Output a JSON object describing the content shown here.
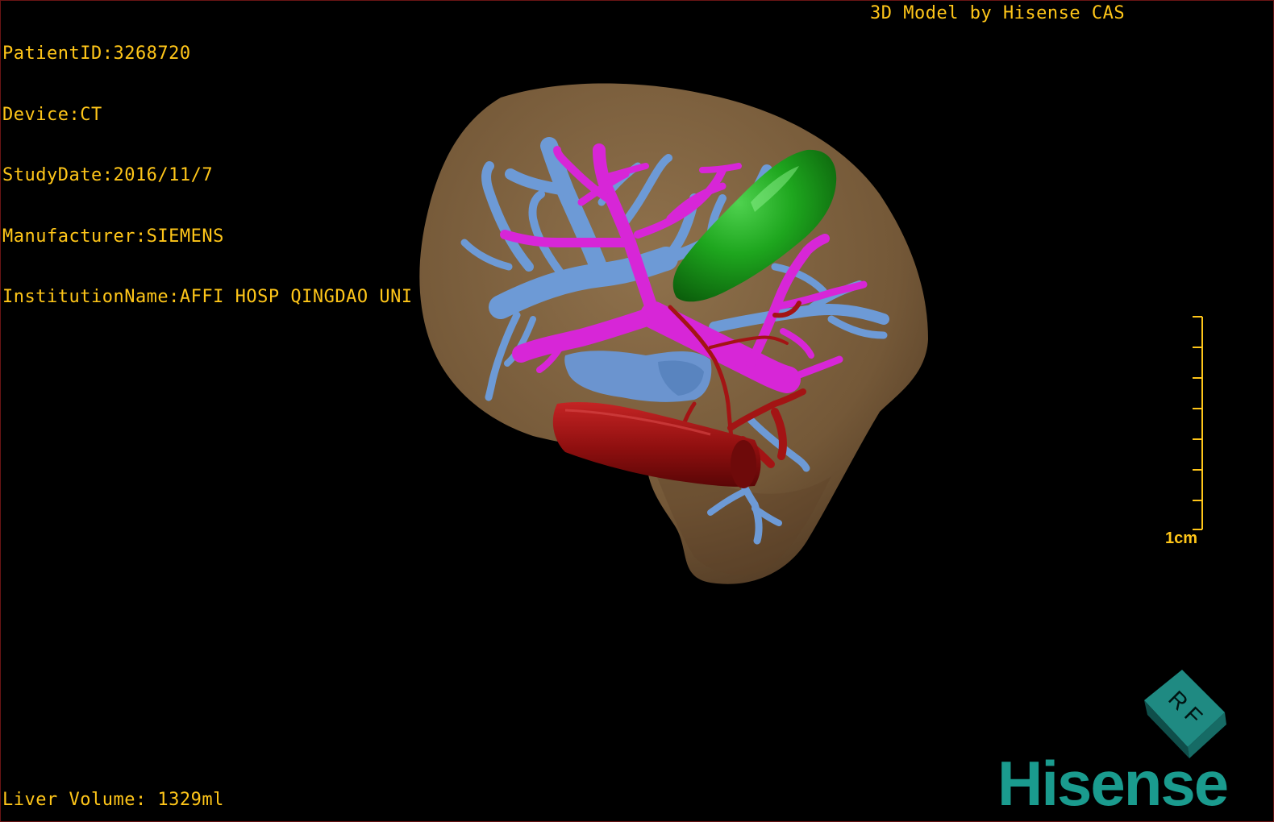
{
  "dicom_info": {
    "patient_id": "PatientID:3268720",
    "device": "Device:CT",
    "study_date": "StudyDate:2016/11/7",
    "manufacturer": "Manufacturer:SIEMENS",
    "institution": "InstitutionName:AFFI HOSP QINGDAO UNI"
  },
  "credit": "3D Model by Hisense CAS",
  "liver_volume": "Liver Volume: 1329ml",
  "scale_bar": {
    "label": "1cm",
    "tick_count": 8
  },
  "orientation_cube": {
    "face_label": "R F"
  },
  "brand": "Hisense",
  "colors": {
    "overlay_text": "#ffc619",
    "liver": "#8a6a44",
    "portal_vein": "#d726d7",
    "hepatic_vein": "#6d9ad6",
    "artery_ivc": "#9e1212",
    "gallbladder": "#1b9e1b",
    "brand": "#1a9b8e"
  },
  "model_parts": [
    "liver",
    "hepatic-vein",
    "portal-vein",
    "inferior-vena-cava",
    "hepatic-artery",
    "gallbladder"
  ]
}
